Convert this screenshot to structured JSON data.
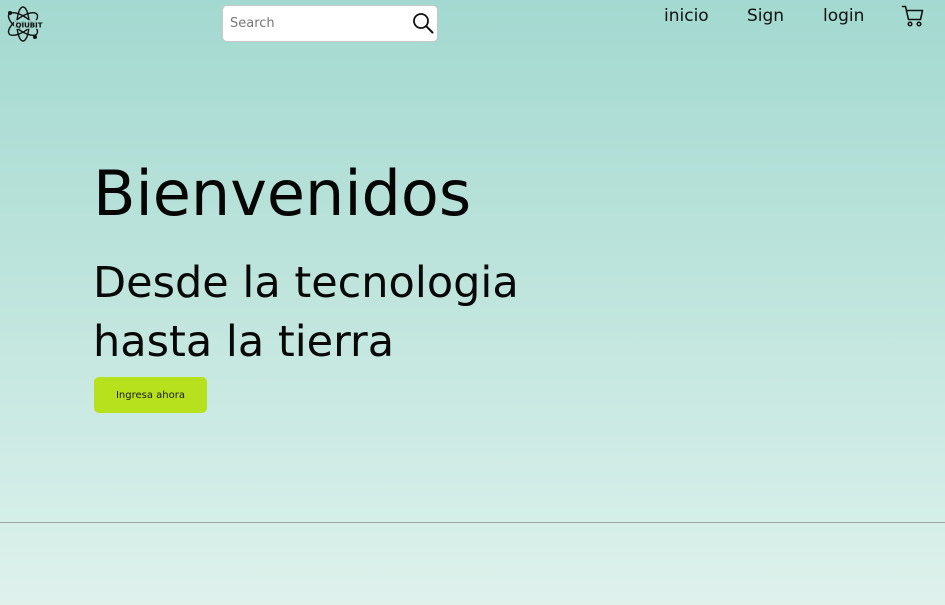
{
  "brand": {
    "logo_text": "QIUBIT",
    "icon": "atom-logo-icon"
  },
  "search": {
    "placeholder": "Search",
    "value": "",
    "icon": "search-icon"
  },
  "nav": {
    "items": [
      {
        "label": "inicio"
      },
      {
        "label": "Sign"
      },
      {
        "label": "login"
      }
    ],
    "cart_icon": "cart-icon"
  },
  "hero": {
    "title": "Bienvenidos",
    "subtitle_line1": "Desde la tecnologia",
    "subtitle_line2": "hasta la tierra",
    "cta_label": "Ingresa ahora"
  },
  "colors": {
    "background_top": "#a3d9d0",
    "background_bottom": "#e0f1ec",
    "cta": "#b7e11d",
    "text": "#0b0b0b"
  }
}
